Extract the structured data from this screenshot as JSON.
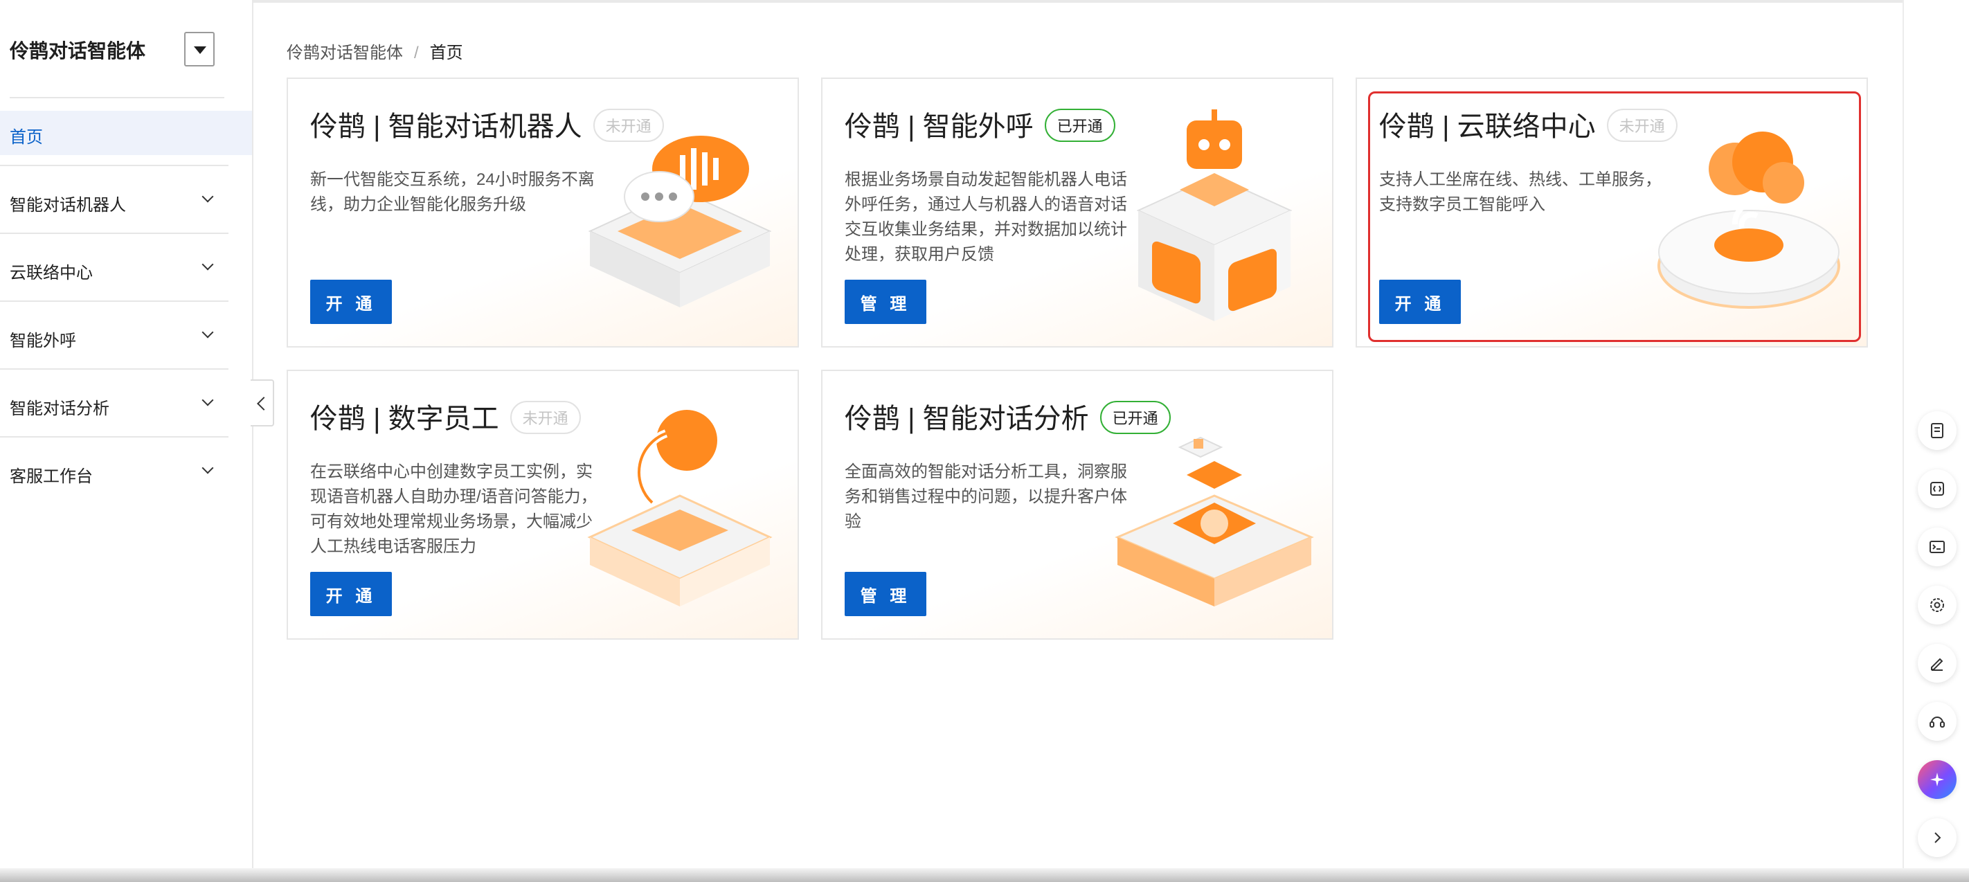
{
  "sidebar": {
    "app_title": "伶鹊对话智能体",
    "home": "首页",
    "items": [
      {
        "label": "智能对话机器人"
      },
      {
        "label": "云联络中心"
      },
      {
        "label": "智能外呼"
      },
      {
        "label": "智能对话分析"
      },
      {
        "label": "客服工作台"
      }
    ]
  },
  "breadcrumb": {
    "root": "伶鹊对话智能体",
    "sep": "/",
    "current": "首页"
  },
  "cards": [
    {
      "title": "伶鹊 | 智能对话机器人",
      "badge": "未开通",
      "badge_state": "inactive",
      "desc": "新一代智能交互系统，24小时服务不离线，助力企业智能化服务升级",
      "button": "开 通",
      "icon": "chat-bubble-illustration"
    },
    {
      "title": "伶鹊 | 智能外呼",
      "badge": "已开通",
      "badge_state": "active",
      "desc": "根据业务场景自动发起智能机器人电话外呼任务，通过人与机器人的语音对话交互收集业务结果，并对数据加以统计处理，获取用户反馈",
      "button": "管 理",
      "icon": "robot-phone-illustration"
    },
    {
      "title": "伶鹊 | 云联络中心",
      "badge": "未开通",
      "badge_state": "inactive",
      "desc": "支持人工坐席在线、热线、工单服务，支持数字员工智能呼入",
      "button": "开 通",
      "icon": "cloud-signal-illustration"
    },
    {
      "title": "伶鹊 | 数字员工",
      "badge": "未开通",
      "badge_state": "inactive",
      "desc": "在云联络中心中创建数字员工实例，实现语音机器人自助办理/语音问答能力，可有效地处理常规业务场景，大幅减少人工热线电话客服压力",
      "button": "开 通",
      "icon": "headset-illustration"
    },
    {
      "title": "伶鹊 | 智能对话分析",
      "badge": "已开通",
      "badge_state": "active",
      "desc": "全面高效的智能对话分析工具，洞察服务和销售过程中的问题，以提升客户体验",
      "button": "管 理",
      "icon": "analysis-illustration"
    }
  ],
  "right_toolbar": [
    "document-icon",
    "api-icon",
    "terminal-icon",
    "settings-icon",
    "edit-icon",
    "support-icon",
    "ai-assistant-icon",
    "chevron-right-icon"
  ],
  "colors": {
    "primary": "#0b62c9",
    "accent_orange": "#ff8a1f",
    "active_badge": "#33b036",
    "highlight_border": "#e0302f"
  }
}
